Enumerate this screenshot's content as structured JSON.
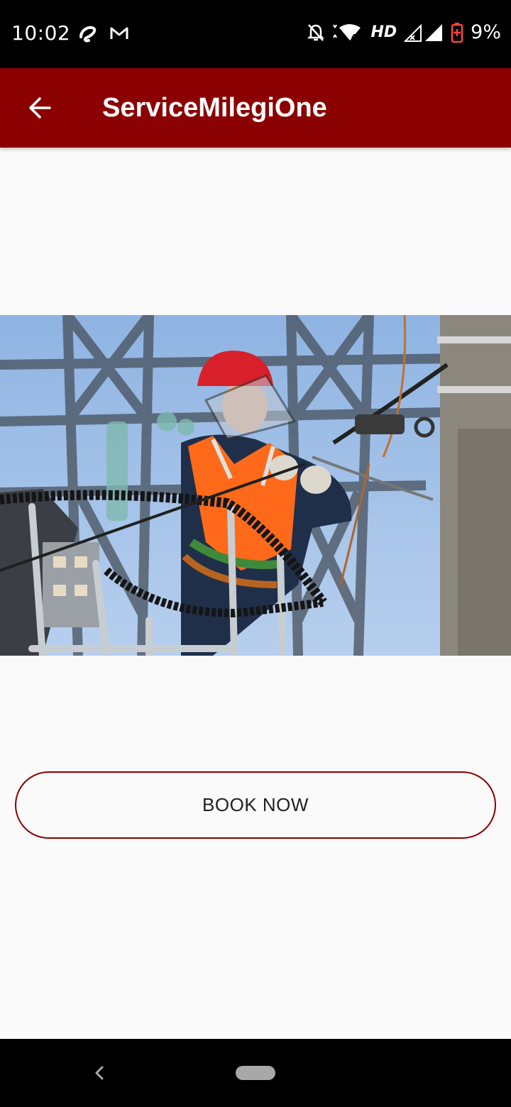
{
  "status_bar": {
    "time": "10:02",
    "network_label": "HD",
    "battery": "9%",
    "icons": [
      "airtel-icon",
      "gmail-icon",
      "mute-icon",
      "wifi-icon",
      "signal-icon",
      "battery-icon"
    ]
  },
  "app_bar": {
    "title": "ServiceMilegiOne",
    "background_color": "#8b0000",
    "back_icon": "arrow-back-icon"
  },
  "hero": {
    "subject": "lineman-at-utility-pole"
  },
  "actions": {
    "book_now_label": "BOOK NOW",
    "accent_color": "#8b0000"
  },
  "nav_bar": {
    "icons": [
      "nav-back-icon",
      "nav-home-pill"
    ]
  }
}
